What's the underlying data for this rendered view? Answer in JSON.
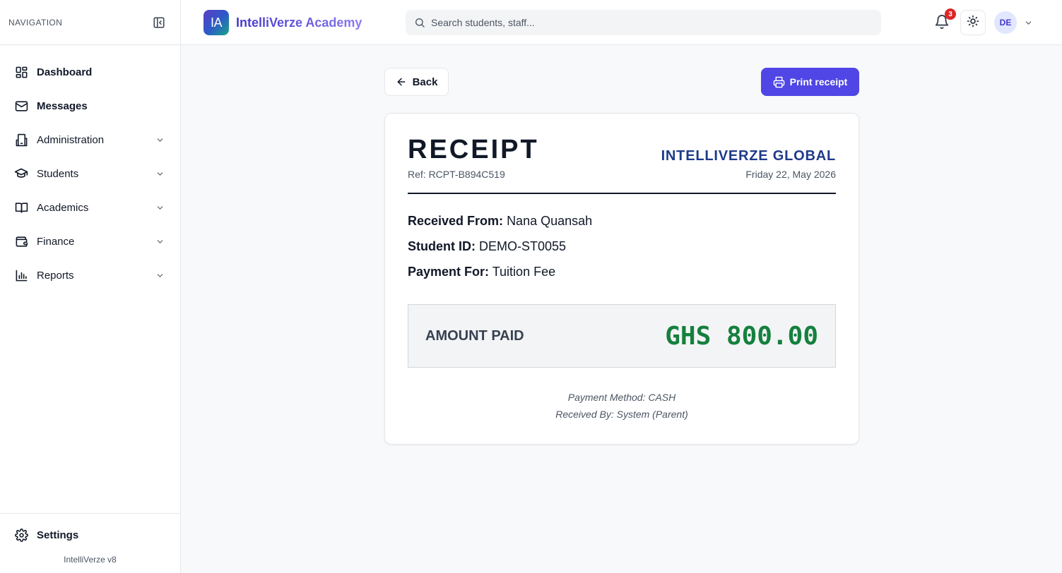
{
  "sidebar": {
    "heading": "NAVIGATION",
    "items": [
      {
        "label": "Dashboard",
        "icon": "dashboard-icon"
      },
      {
        "label": "Messages",
        "icon": "mail-icon"
      },
      {
        "label": "Administration",
        "icon": "building-icon"
      },
      {
        "label": "Students",
        "icon": "graduation-cap-icon"
      },
      {
        "label": "Academics",
        "icon": "book-open-icon"
      },
      {
        "label": "Finance",
        "icon": "wallet-icon"
      },
      {
        "label": "Reports",
        "icon": "bar-chart-icon"
      }
    ],
    "settings_label": "Settings",
    "version": "IntelliVerze v8"
  },
  "topbar": {
    "logo_text": "IA",
    "brand_name": "IntelliVerze Academy",
    "search_placeholder": "Search students, staff...",
    "notification_count": "3",
    "avatar_initials": "DE"
  },
  "actions": {
    "back_label": "Back",
    "print_label": "Print receipt"
  },
  "receipt": {
    "title": "RECEIPT",
    "ref": "Ref: RCPT-B894C519",
    "organization": "INTELLIVERZE GLOBAL",
    "date": "Friday 22, May 2026",
    "received_from_label": "Received From:",
    "received_from": "Nana Quansah",
    "student_id_label": "Student ID:",
    "student_id": "DEMO-ST0055",
    "payment_for_label": "Payment For:",
    "payment_for": "Tuition Fee",
    "amount_label": "AMOUNT PAID",
    "amount": "GHS 800.00",
    "payment_method": "Payment Method: CASH",
    "received_by": "Received By: System (Parent)"
  },
  "colors": {
    "accent": "#4f46e5",
    "org_text": "#1e3a8a",
    "amount_text": "#15803d",
    "badge": "#dc2626"
  }
}
